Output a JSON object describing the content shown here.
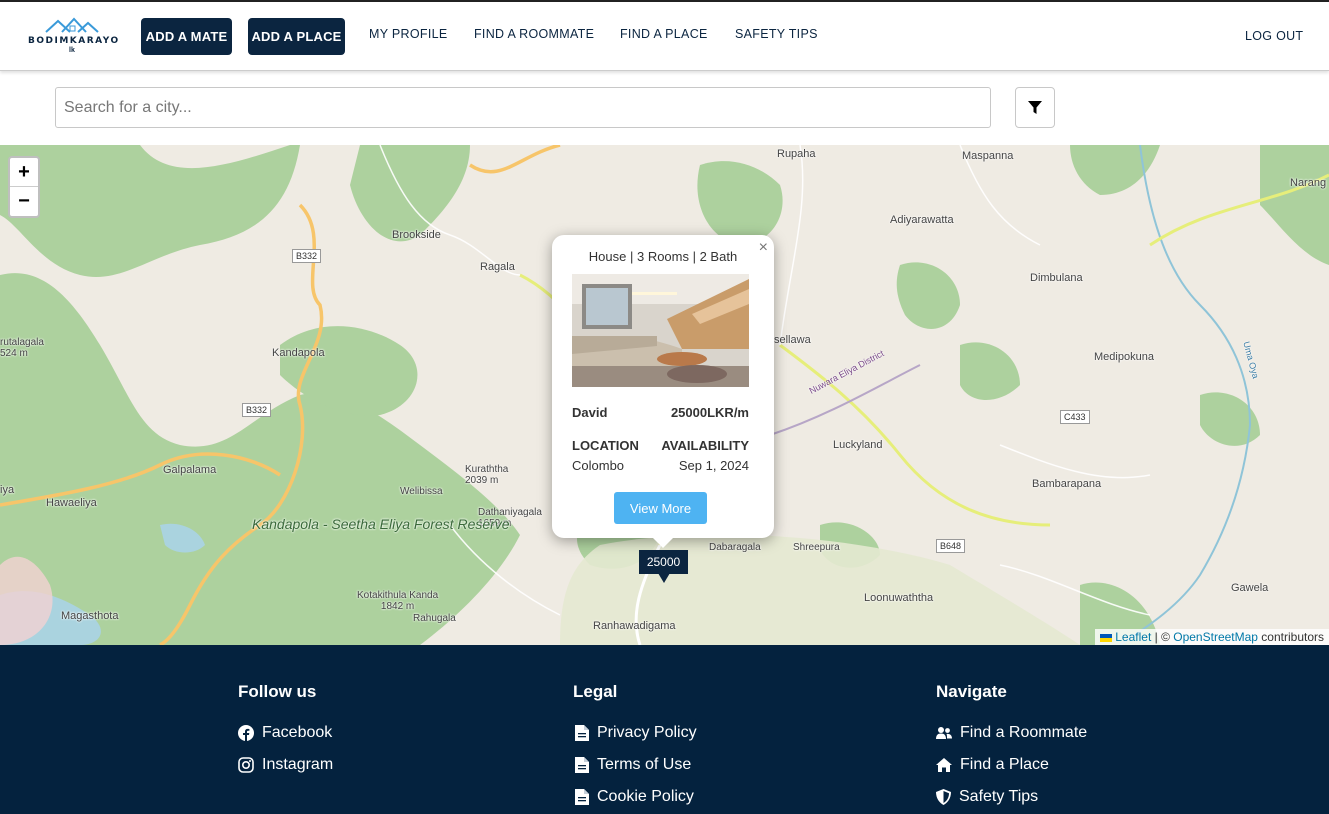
{
  "brand": {
    "logo_text": "BODIMKARAYO",
    "logo_sub": "lk"
  },
  "nav": {
    "add_mate": "ADD A MATE",
    "add_place": "ADD A PLACE",
    "links": [
      "MY PROFILE",
      "FIND A ROOMMATE",
      "FIND A PLACE",
      "SAFETY TIPS"
    ],
    "logout": "LOG OUT"
  },
  "search": {
    "placeholder": "Search for a city..."
  },
  "map": {
    "labels": [
      "Rupaha",
      "Maspanna",
      "Narang",
      "Adiyarawatta",
      "Brookside",
      "Ragala",
      "Dimbulana",
      "Kandapola",
      "sellawa",
      "Medipokuna",
      "Luckyland",
      "Galpalama",
      "Hawaeliya",
      "Bambarapana",
      "Welibissa",
      "Dabaragala",
      "Shreepura",
      "Gawela",
      "Magasthota",
      "Rahugala",
      "Loonuwaththa",
      "Ranhawadigama",
      "iya",
      "Nuwara Eliya District",
      "Uma Oya"
    ],
    "peaks": [
      {
        "name": "Kuraththa",
        "elev": "2039 m"
      },
      {
        "name": "Dathaniyagala",
        "elev": "1659 m"
      },
      {
        "name": "Kotakithula Kanda",
        "elev": "1842 m"
      },
      {
        "name": "rutalagala",
        "elev": "524 m"
      }
    ],
    "forest_name": "Kandapola - Seetha Eliya Forest Reserve",
    "roads": [
      "B332",
      "B332",
      "C433",
      "B648"
    ],
    "zoom_in": "+",
    "zoom_out": "−",
    "attribution": {
      "leaflet": "Leaflet",
      "sep": " | © ",
      "osm": "OpenStreetMap",
      "contributors": " contributors"
    }
  },
  "popup": {
    "title": "House | 3 Rooms | 2 Bath",
    "owner": "David",
    "price": "25000LKR/m",
    "location_label": "LOCATION",
    "availability_label": "AVAILABILITY",
    "location": "Colombo",
    "availability": "Sep 1, 2024",
    "view_more": "View More",
    "close": "×"
  },
  "marker": {
    "price": "25000"
  },
  "footer": {
    "follow": {
      "heading": "Follow us",
      "items": [
        {
          "label": "Facebook",
          "icon": "facebook-icon"
        },
        {
          "label": "Instagram",
          "icon": "instagram-icon"
        }
      ]
    },
    "legal": {
      "heading": "Legal",
      "items": [
        {
          "label": "Privacy Policy",
          "icon": "document-icon"
        },
        {
          "label": "Terms of Use",
          "icon": "document-icon"
        },
        {
          "label": "Cookie Policy",
          "icon": "document-icon"
        }
      ]
    },
    "navigate": {
      "heading": "Navigate",
      "items": [
        {
          "label": "Find a Roommate",
          "icon": "users-icon"
        },
        {
          "label": "Find a Place",
          "icon": "home-icon"
        },
        {
          "label": "Safety Tips",
          "icon": "shield-icon"
        }
      ]
    }
  },
  "colors": {
    "brand_dark": "#0b2540",
    "footer_bg": "#04223e",
    "button_blue": "#4eb3f2",
    "map_bg": "#efebe3",
    "forest": "#add19e"
  }
}
